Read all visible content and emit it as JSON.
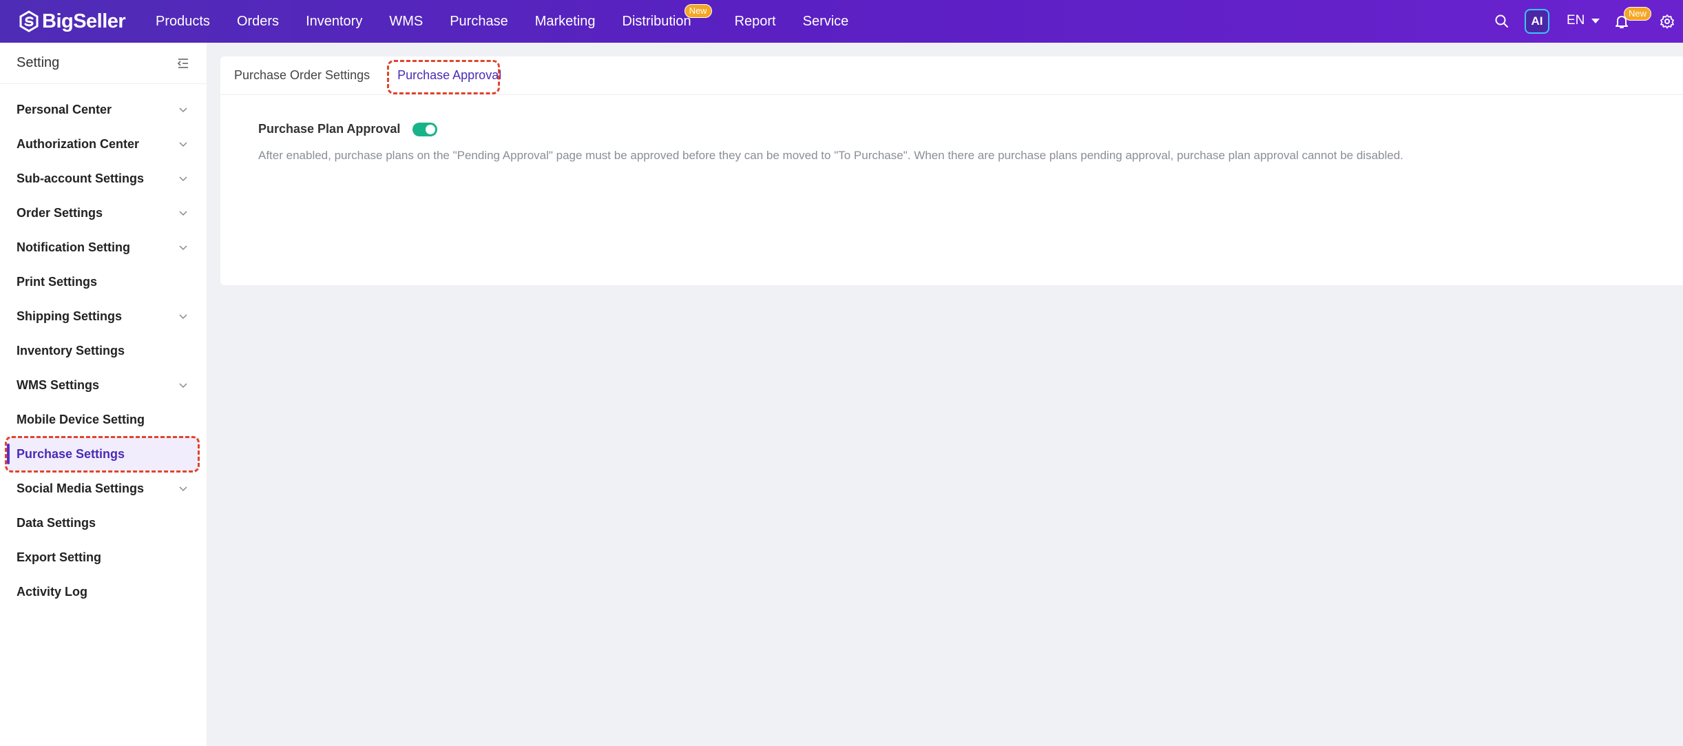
{
  "brand": {
    "name": "BigSeller"
  },
  "nav": {
    "items": [
      {
        "label": "Products"
      },
      {
        "label": "Orders"
      },
      {
        "label": "Inventory"
      },
      {
        "label": "WMS"
      },
      {
        "label": "Purchase"
      },
      {
        "label": "Marketing"
      },
      {
        "label": "Distribution",
        "badge": "New"
      },
      {
        "label": "Report"
      },
      {
        "label": "Service"
      }
    ],
    "ai_label": "AI",
    "language": "EN",
    "notification_badge": "New"
  },
  "sidebar": {
    "title": "Setting",
    "items": [
      {
        "label": "Personal Center",
        "expandable": true
      },
      {
        "label": "Authorization Center",
        "expandable": true
      },
      {
        "label": "Sub-account Settings",
        "expandable": true
      },
      {
        "label": "Order Settings",
        "expandable": true
      },
      {
        "label": "Notification Setting",
        "expandable": true
      },
      {
        "label": "Print Settings",
        "expandable": false
      },
      {
        "label": "Shipping Settings",
        "expandable": true
      },
      {
        "label": "Inventory Settings",
        "expandable": false
      },
      {
        "label": "WMS Settings",
        "expandable": true
      },
      {
        "label": "Mobile Device Setting",
        "expandable": false
      },
      {
        "label": "Purchase Settings",
        "expandable": false,
        "active": true
      },
      {
        "label": "Social Media Settings",
        "expandable": true
      },
      {
        "label": "Data Settings",
        "expandable": false
      },
      {
        "label": "Export Setting",
        "expandable": false
      },
      {
        "label": "Activity Log",
        "expandable": false
      }
    ]
  },
  "tabs": [
    {
      "label": "Purchase Order Settings",
      "active": false
    },
    {
      "label": "Purchase Approval",
      "active": true
    }
  ],
  "setting": {
    "label": "Purchase Plan Approval",
    "enabled": true,
    "description": "After enabled, purchase plans on the \"Pending Approval\" page must be approved before they can be moved to \"To Purchase\". When there are purchase plans pending approval, purchase plan approval cannot be disabled."
  },
  "colors": {
    "nav_gradient_start": "#4f2cb6",
    "nav_gradient_end": "#6a22cf",
    "accent": "#4b2bb5",
    "toggle_on": "#19b38a",
    "badge": "#f5a623",
    "highlight": "#e0442b"
  }
}
